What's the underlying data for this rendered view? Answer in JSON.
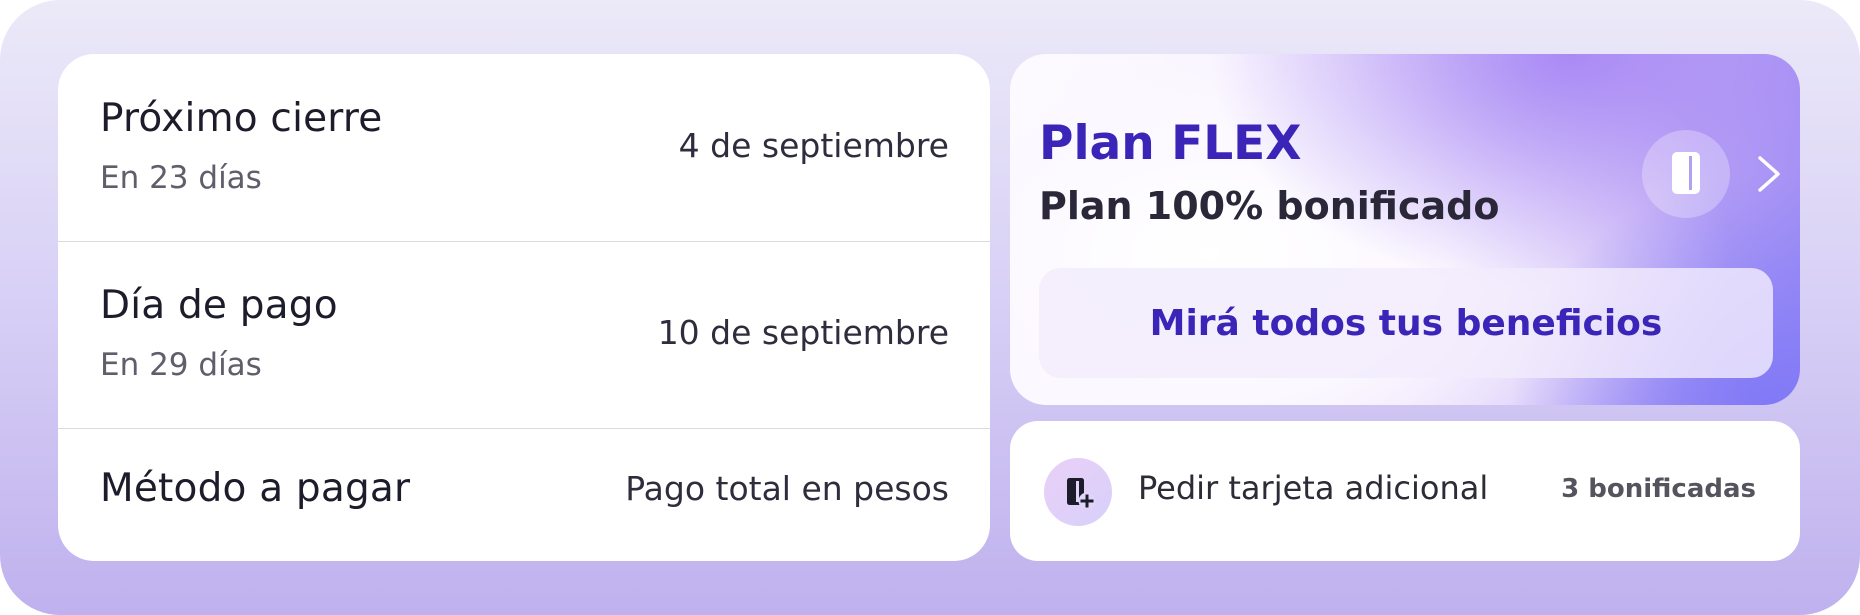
{
  "summary": {
    "rows": [
      {
        "label": "Próximo cierre",
        "sub": "En 23 días",
        "value": "4 de septiembre"
      },
      {
        "label": "Día de pago",
        "sub": "En 29 días",
        "value": "10 de septiembre"
      },
      {
        "label": "Método a pagar",
        "value": "Pago total en pesos"
      }
    ]
  },
  "plan": {
    "title": "Plan FLEX",
    "subtitle": "Plan 100% bonificado",
    "cta_label": "Mirá todos tus beneficios",
    "icon": "card-icon",
    "accent": "#3a25b8"
  },
  "additional": {
    "label": "Pedir tarjeta adicional",
    "count": "3 bonificadas",
    "icon": "add-card-icon"
  }
}
